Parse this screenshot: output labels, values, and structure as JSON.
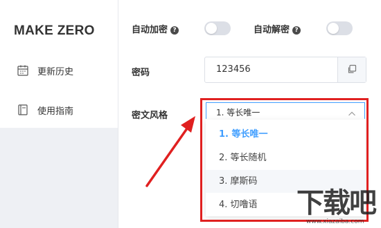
{
  "colors": {
    "accent": "#409eff",
    "annotation": "#e02020",
    "toggle_off": "#dcdfe6",
    "sidebar_bg": "#eef0f4"
  },
  "sidebar": {
    "logo": "MAKE ZERO",
    "items": [
      {
        "icon": "calendar-icon",
        "label": "更新历史"
      },
      {
        "icon": "book-icon",
        "label": "使用指南"
      }
    ]
  },
  "settings": {
    "auto_encrypt": {
      "label": "自动加密",
      "help": "?",
      "enabled": false
    },
    "auto_decrypt": {
      "label": "自动解密",
      "help": "?",
      "enabled": false
    },
    "password": {
      "label": "密码",
      "value": "123456",
      "copy_icon": "copy-icon"
    },
    "style": {
      "label": "密文风格",
      "selected": "1. 等长唯一",
      "options": [
        "1. 等长唯一",
        "2. 等长随机",
        "3. 摩斯码",
        "4. 切噜语"
      ]
    }
  },
  "watermark": {
    "text": "下载吧",
    "url": "www.xiazaiba.com"
  }
}
